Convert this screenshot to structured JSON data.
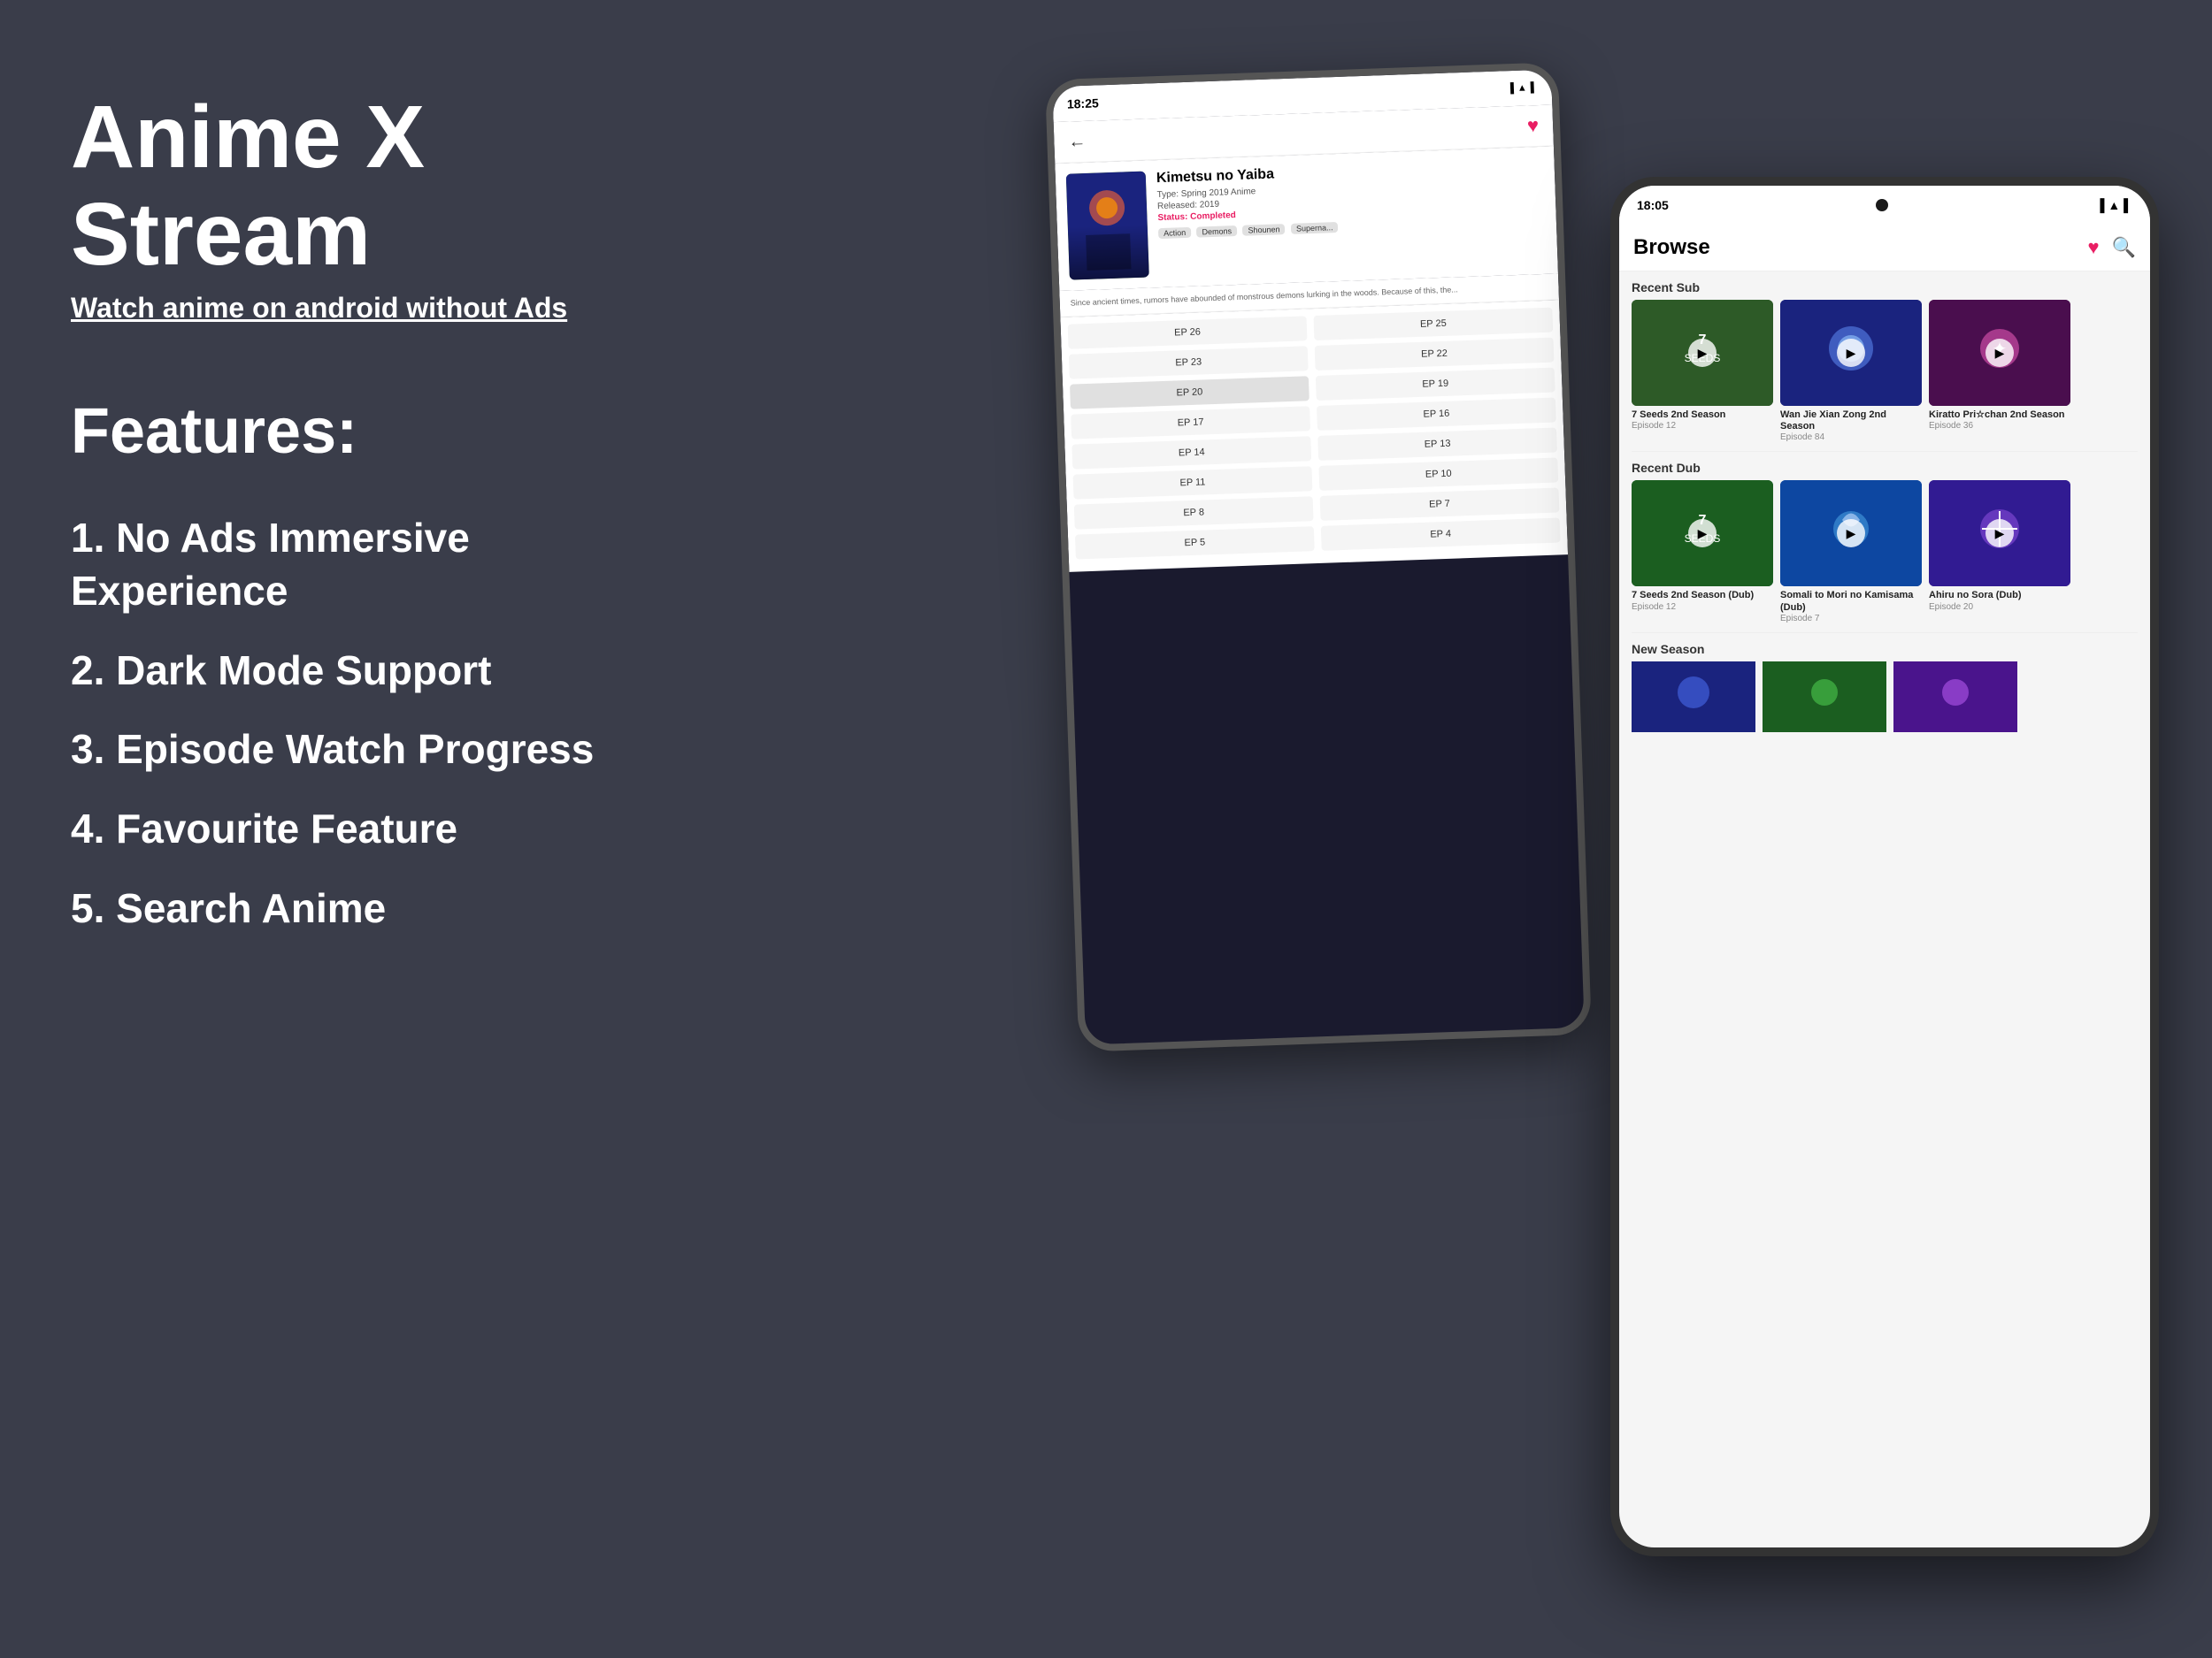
{
  "page": {
    "background_color": "#3a3d4a"
  },
  "header": {
    "title": "Anime X Stream",
    "subtitle": "Watch anime on android without Ads"
  },
  "features": {
    "heading": "Features:",
    "items": [
      {
        "id": 1,
        "text": "1. No Ads Immersive Experience"
      },
      {
        "id": 2,
        "text": "2. Dark Mode Support"
      },
      {
        "id": 3,
        "text": "3. Episode Watch Progress"
      },
      {
        "id": 4,
        "text": "4. Favourite Feature"
      },
      {
        "id": 5,
        "text": "5. Search Anime"
      }
    ]
  },
  "phone_back": {
    "status_bar": {
      "time": "18:25",
      "icons": "📶 🔋"
    },
    "anime": {
      "title": "Kimetsu no Yaiba",
      "type": "Type: Spring 2019 Anime",
      "released": "Released: 2019",
      "status": "Status: Completed",
      "tags": [
        "Action",
        "Demons",
        "Shounen",
        "Superna..."
      ],
      "description": "Since ancient times, rumors have abounded of monstrous demons lurking in the woods. Because of this, the..."
    },
    "episodes": [
      [
        "EP 26",
        "EP 25"
      ],
      [
        "EP 23",
        "EP 22"
      ],
      [
        "EP 20",
        "EP 19"
      ],
      [
        "EP 17",
        "EP 16"
      ],
      [
        "EP 14",
        "EP 13"
      ],
      [
        "EP 11",
        "EP 10"
      ],
      [
        "EP 8",
        "EP 7"
      ],
      [
        "EP 5",
        "EP 4"
      ]
    ]
  },
  "phone_front": {
    "status_bar": {
      "time": "18:05",
      "icons": "📷 📶 🔋"
    },
    "browse_title": "Browse",
    "sections": [
      {
        "id": "recent_sub",
        "title": "Recent Sub",
        "cards": [
          {
            "title": "7 Seeds 2nd Season",
            "episode": "Episode 12",
            "bg": "card-bg-1"
          },
          {
            "title": "Wan Jie Xian Zong 2nd Season",
            "episode": "Episode 84",
            "bg": "card-bg-2"
          },
          {
            "title": "Kiratto Pri☆chan 2nd Season",
            "episode": "Episode 36",
            "bg": "card-bg-3"
          }
        ]
      },
      {
        "id": "recent_dub",
        "title": "Recent Dub",
        "cards": [
          {
            "title": "7 Seeds 2nd Season (Dub)",
            "episode": "Episode 12",
            "bg": "card-bg-4"
          },
          {
            "title": "Somali to Mori no Kamisama (Dub)",
            "episode": "Episode 7",
            "bg": "card-bg-5"
          },
          {
            "title": "Ahiru no Sora (Dub)",
            "episode": "Episode 20",
            "bg": "card-bg-6"
          }
        ]
      },
      {
        "id": "new_season",
        "title": "New Season",
        "cards": [
          {
            "title": "",
            "bg": "card-bg-ns1"
          },
          {
            "title": "",
            "bg": "card-bg-ns2"
          },
          {
            "title": "",
            "bg": "card-bg-ns3"
          }
        ]
      }
    ]
  }
}
